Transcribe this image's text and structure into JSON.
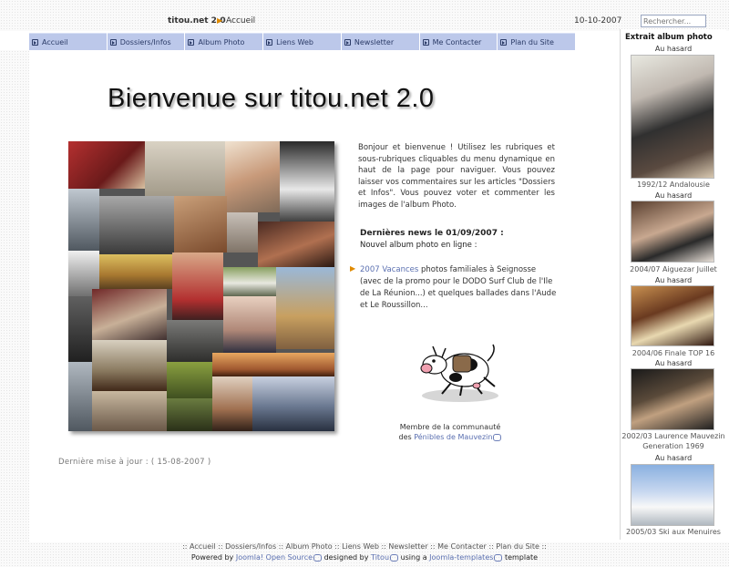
{
  "header": {
    "site_name": "titou.net 2.0",
    "breadcrumb": "Accueil",
    "date": "10-10-2007",
    "search_placeholder": "Rechercher..."
  },
  "menu": {
    "items": [
      "Accueil",
      "Dossiers/Infos",
      "Album Photo",
      "Liens Web",
      "Newsletter",
      "Me Contacter",
      "Plan du Site"
    ]
  },
  "main": {
    "welcome_title": "Bienvenue sur titou.net 2.0",
    "intro": "Bonjour et bienvenue ! Utilisez les rubriques et sous-rubriques cliquables du menu dynamique en haut de la page pour naviguer. Vous pouvez laisser vos commentaires sur les articles \"Dossiers et Infos\". Vous pouvez voter et commenter les images de l'album Photo.",
    "news_title": "Dernières news le 01/09/2007 :",
    "news_line": "Nouvel album photo en ligne :",
    "news_item_link": "2007 Vacances",
    "news_item_text": "photos familiales à Seignosse (avec de la promo pour le DODO Surf Club de l'Ile de La Réunion...) et quelques ballades dans l'Aude et Le Roussillon...",
    "member_line1": "Membre de la communauté",
    "member_prefix": "des",
    "member_link": "Pénibles de Mauvezin",
    "last_update": "Dernière mise à jour : ( 15-08-2007 )"
  },
  "sidebar": {
    "title": "Extrait album photo",
    "photos": [
      {
        "label": "Au hasard",
        "caption": "1992/12 Andalousie"
      },
      {
        "label": "Au hasard",
        "caption": "2004/07 Aiguezar Juillet"
      },
      {
        "label": "Au hasard",
        "caption": "2004/06 Finale TOP 16"
      },
      {
        "label": "Au hasard",
        "caption": "2002/03 Laurence Mauvezin Generation 1969"
      },
      {
        "label": "Au hasard",
        "caption": "2005/03 Ski aux Menuires"
      }
    ]
  },
  "footer": {
    "links": [
      "Accueil",
      "Dossiers/Infos",
      "Album Photo",
      "Liens Web",
      "Newsletter",
      "Me Contacter",
      "Plan du Site"
    ],
    "powered_by": "Powered by",
    "joomla_link": "Joomla! Open Source",
    "designed_by": "designed by",
    "titou_link": "Titou",
    "using": "using a",
    "templates_link": "Joomla-templates",
    "template_word": "template"
  },
  "colors": {
    "menu_bg": "#bcc8ea",
    "link": "#5a6fb0",
    "accent_arrow": "#e08a00"
  }
}
